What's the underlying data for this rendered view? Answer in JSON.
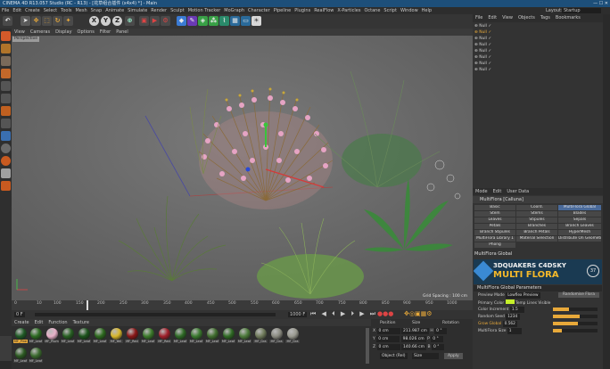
{
  "window": {
    "title": "CINEMA 4D R13.057 Studio (RC - R13) - [花草组合插件 (x4x4) *] - Main",
    "controls": "— ☐ ✕"
  },
  "menubar": [
    "File",
    "Edit",
    "Create",
    "Select",
    "Tools",
    "Mesh",
    "Snap",
    "Animate",
    "Simulate",
    "Render",
    "Sculpt",
    "Motion Tracker",
    "MoGraph",
    "Character",
    "Pipeline",
    "Plugins",
    "RealFlow",
    "X-Particles",
    "Octane",
    "Script",
    "Window",
    "Help"
  ],
  "layout": {
    "label": "Layout:",
    "value": "Startup"
  },
  "toolbar": {
    "axis_buttons": [
      "X",
      "Y",
      "Z"
    ]
  },
  "viewport": {
    "menu": [
      "View",
      "Cameras",
      "Display",
      "Options",
      "Filter",
      "Panel"
    ],
    "label": "Perspective",
    "grid_spacing": "Grid Spacing : 100 cm"
  },
  "timeline": {
    "ticks": [
      "0",
      "10",
      "100",
      "150",
      "200",
      "250",
      "300",
      "350",
      "400",
      "450",
      "500",
      "550",
      "600",
      "650",
      "700",
      "750",
      "800",
      "850",
      "900",
      "950",
      "1000"
    ],
    "start": "0 F",
    "current": "0 F",
    "end": "1000 F",
    "frame_box": "1000 F"
  },
  "materials": {
    "menu": [
      "Create",
      "Edit",
      "Function",
      "Texture"
    ],
    "items": [
      {
        "name": "MF_Pine",
        "color": "#1f5a25"
      },
      {
        "name": "MF_Leaf",
        "color": "#2d6b22"
      },
      {
        "name": "MF_Plum",
        "color": "#e8b0c8"
      },
      {
        "name": "MF_Leaf",
        "color": "#275f22"
      },
      {
        "name": "MF_Leaf",
        "color": "#1c531c"
      },
      {
        "name": "MF_Leaf",
        "color": "#2d6a1e"
      },
      {
        "name": "MF_Yell",
        "color": "#d8b72a"
      },
      {
        "name": "MF_Red",
        "color": "#8a1717"
      },
      {
        "name": "MF_Leaf",
        "color": "#3b7a2a"
      },
      {
        "name": "MF_Red",
        "color": "#a0202a"
      },
      {
        "name": "MF_Leaf",
        "color": "#2e6a25"
      },
      {
        "name": "MF_Leaf",
        "color": "#3a7a2e"
      },
      {
        "name": "MF_Leaf",
        "color": "#416e2f"
      },
      {
        "name": "MF_Leaf",
        "color": "#2f6a24"
      },
      {
        "name": "MF_Leaf",
        "color": "#4c7a3a"
      },
      {
        "name": "MF_Gra",
        "color": "#6f7a5a"
      },
      {
        "name": "MF_Gra",
        "color": "#8a8a80"
      },
      {
        "name": "MF_Gra",
        "color": "#9a9a90"
      },
      {
        "name": "MF_Leaf",
        "color": "#2c5a22"
      },
      {
        "name": "MF_Leaf",
        "color": "#3b6a2e"
      }
    ]
  },
  "coords": {
    "headers": [
      "Position",
      "Size",
      "Rotation"
    ],
    "rows": [
      {
        "axis": "X",
        "pos": "0 cm",
        "size": "211.987 cm",
        "rot_label": "H",
        "rot": "0 °"
      },
      {
        "axis": "Y",
        "pos": "0 cm",
        "size": "98.026 cm",
        "rot_label": "P",
        "rot": "0 °"
      },
      {
        "axis": "Z",
        "pos": "0 cm",
        "size": "140.66 cm",
        "rot_label": "B",
        "rot": "0 °"
      }
    ],
    "mode": "Object (Rel)",
    "size_mode": "Size",
    "apply": "Apply"
  },
  "objects": {
    "menu": [
      "File",
      "Edit",
      "View",
      "Objects",
      "Tags",
      "Bookmarks"
    ],
    "items": [
      "Null",
      "Null",
      "Null",
      "Null",
      "Null",
      "Null",
      "Null",
      "Null"
    ]
  },
  "attributes": {
    "menu": [
      "Mode",
      "Edit",
      "User Data"
    ],
    "title": "MultiFlora [Calluna]",
    "tabs": [
      "Basic",
      "Coord.",
      "MultiFlora Global",
      "Stem",
      "Stems",
      "Blades",
      "Leaves",
      "Stipules",
      "Sepals",
      "Petals",
      "Branches",
      "Branch Leaves",
      "Branch Stipules",
      "Branch Petals",
      "HyperMesh",
      "MultiFlora Library 1",
      "Material Selection",
      "Distribute On Geometry",
      "Phong"
    ],
    "section": "MultiFlora Global",
    "banner": {
      "line1": "3DQUAKERS C4DSKY",
      "line2": "MULTI FLORA",
      "version": "37"
    },
    "params_title": "MultiFlora Global Parameters",
    "params": [
      {
        "label": "Preview Mode",
        "value": "Lowflex Preview"
      },
      {
        "label": "Primary Color",
        "value": "Temp Lines Visible"
      },
      {
        "label": "Color Increment",
        "value": "1.5"
      },
      {
        "label": "Random Seed",
        "value": "1234"
      },
      {
        "label": "Grow Global",
        "value": "0.562"
      },
      {
        "label": "MultiFlora Size",
        "value": "1"
      }
    ],
    "randomize": "Randomise Flora"
  }
}
